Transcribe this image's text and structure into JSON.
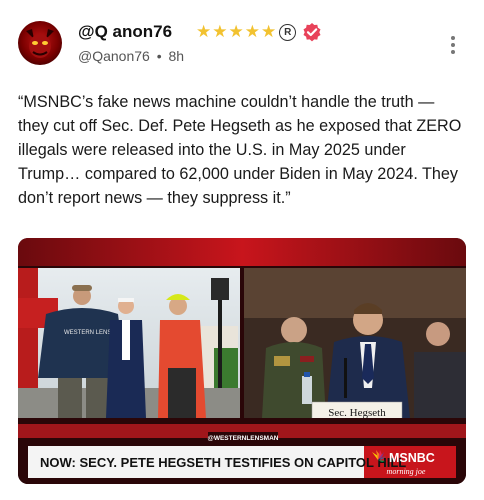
{
  "post": {
    "display_name": "@Q anon76",
    "stars": [
      "★",
      "★",
      "★",
      "★",
      "★"
    ],
    "registered_mark": "R",
    "handle": "@Qanon76",
    "separator": "•",
    "time_ago": "8h",
    "text": "“MSNBC’s fake news machine couldn’t handle the truth — they cut off Sec. Def. Pete Hegseth as he exposed that ZERO illegals were released into the U.S. in May 2025 under Trump… compared to 62,000 under Biden in May 2024. They don’t report news — they suppress it.”"
  },
  "video": {
    "nameplate": "Sec. Hegseth",
    "source_tag": "@WESTERNLENSMAN",
    "headline": "NOW: SECY. PETE HEGSETH TESTIFIES ON CAPITOL HILL",
    "network": "MSNBC",
    "show": "morning joe",
    "tshirt_text": "WESTERN LENSMAN"
  },
  "colors": {
    "star": "#f2c230",
    "verified": "#e8425a",
    "banner_red": "#c8151c",
    "text": "#1a1a1a",
    "meta": "#555555"
  },
  "icons": {
    "verified": "verified-check-icon",
    "more": "more-vertical-icon",
    "network_logo": "peacock-logo-icon"
  }
}
